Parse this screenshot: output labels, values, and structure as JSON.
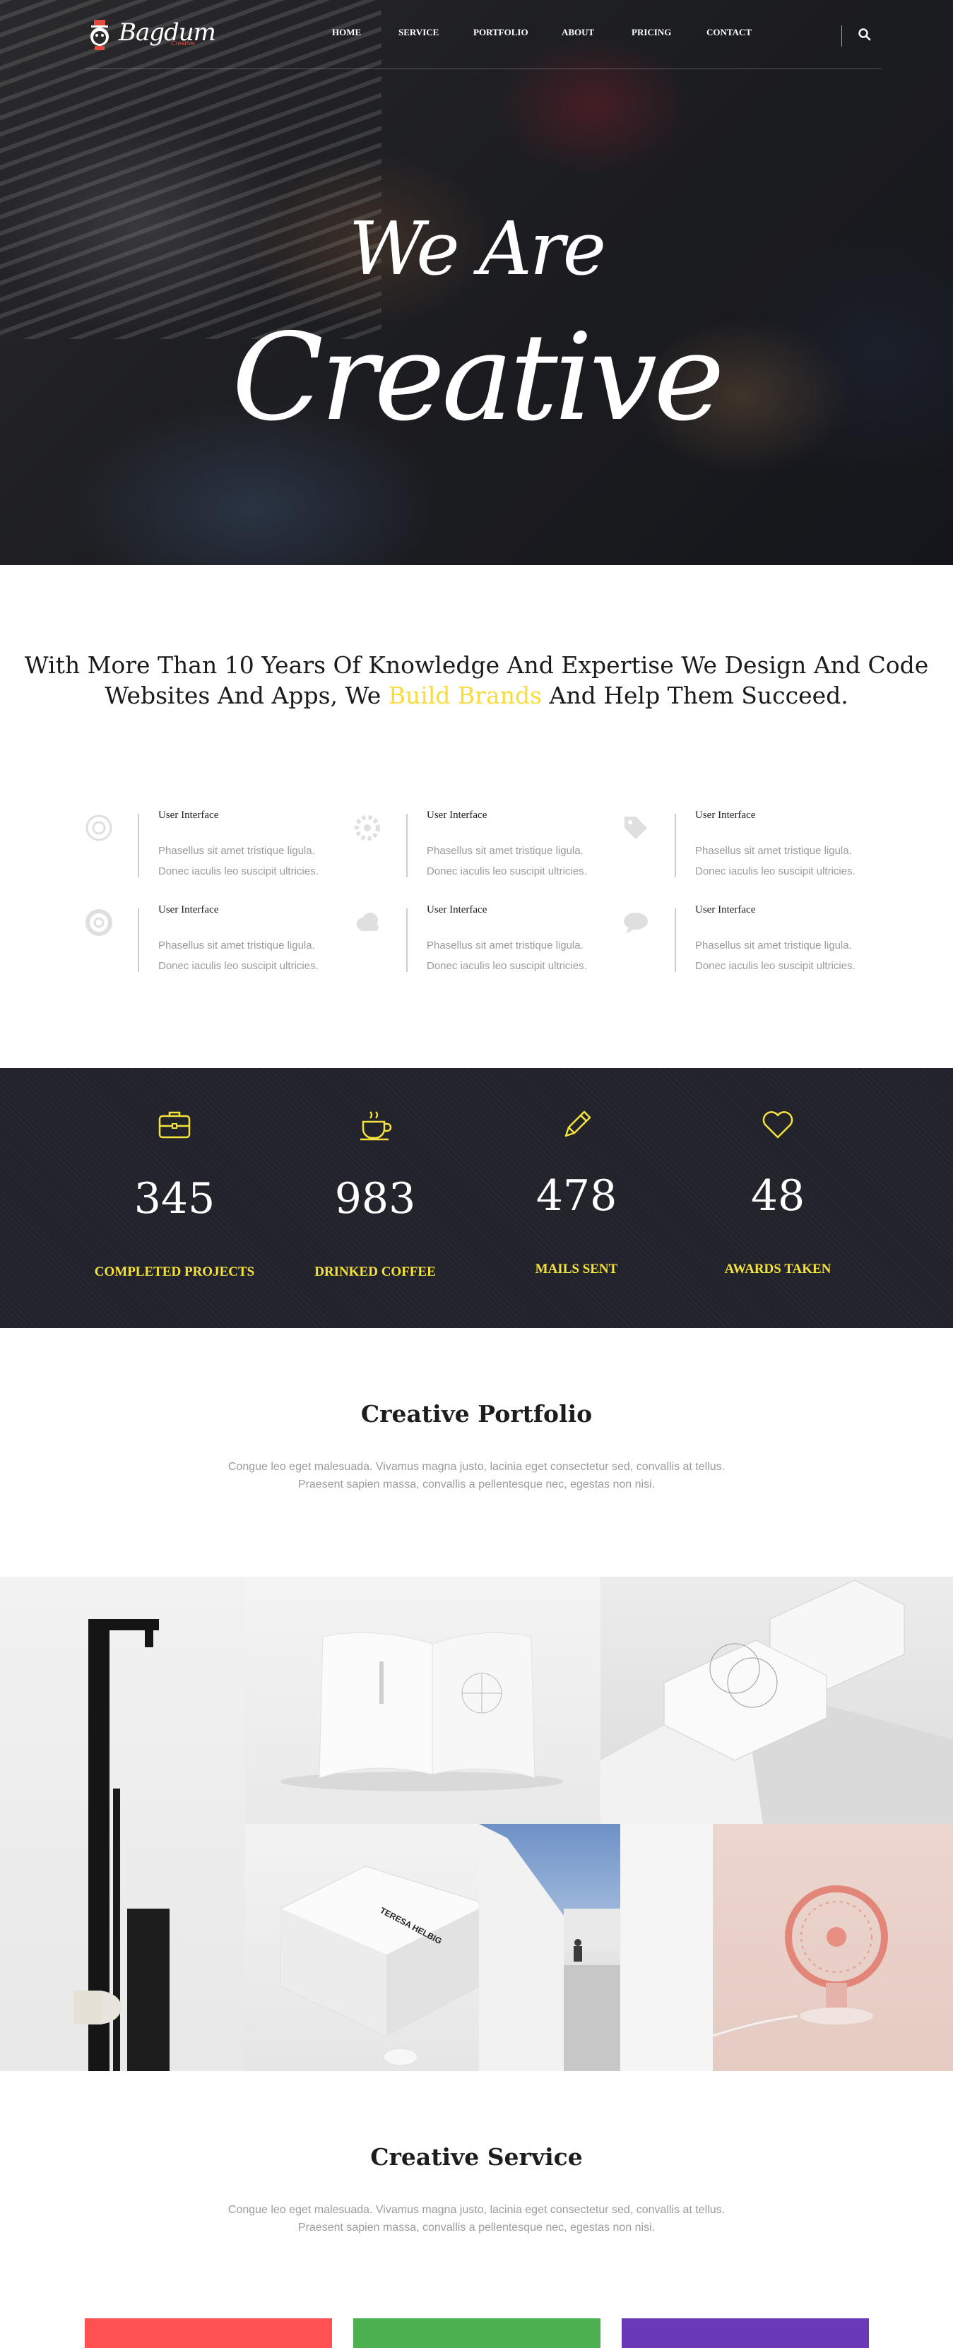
{
  "brand": {
    "name": "Bagdum",
    "tagline": "Creative"
  },
  "nav": {
    "items": [
      "HOME",
      "SERVICE",
      "PORTFOLIO",
      "ABOUT",
      "PRICING",
      "CONTACT"
    ],
    "search_icon": "search-icon"
  },
  "hero": {
    "line1": "We Are",
    "line2": "Creative"
  },
  "intro": {
    "text_before": "With More Than 10 Years Of Knowledge And Expertise We Design And Code Websites And Apps, We ",
    "highlight": "Build Brands",
    "text_after": " And Help Them Succeed.",
    "highlight_color": "#f7dc3c"
  },
  "features": [
    {
      "title": "User Interface",
      "line1": "Phasellus sit amet tristique ligula.",
      "line2": "Donec iaculis leo suscipit ultricies.",
      "icon": "target-icon"
    },
    {
      "title": "User Interface",
      "line1": "Phasellus sit amet tristique ligula.",
      "line2": "Donec iaculis leo suscipit ultricies.",
      "icon": "settings-icon"
    },
    {
      "title": "User Interface",
      "line1": "Phasellus sit amet tristique ligula.",
      "line2": "Donec iaculis leo suscipit ultricies.",
      "icon": "tag-icon"
    },
    {
      "title": "User Interface",
      "line1": "Phasellus sit amet tristique ligula.",
      "line2": "Donec iaculis leo suscipit ultricies.",
      "icon": "lifebuoy-icon"
    },
    {
      "title": "User Interface",
      "line1": "Phasellus sit amet tristique ligula.",
      "line2": "Donec iaculis leo suscipit ultricies.",
      "icon": "cloud-icon"
    },
    {
      "title": "User Interface",
      "line1": "Phasellus sit amet tristique ligula.",
      "line2": "Donec iaculis leo suscipit ultricies.",
      "icon": "chat-icon"
    }
  ],
  "stats": [
    {
      "value": "345",
      "label": "COMPLETED PROJECTS",
      "icon": "briefcase-icon"
    },
    {
      "value": "983",
      "label": "DRINKED COFFEE",
      "icon": "coffee-icon"
    },
    {
      "value": "478",
      "label": "MAILS SENT",
      "icon": "pencil-icon"
    },
    {
      "value": "48",
      "label": "AWARDS TAKEN",
      "icon": "heart-icon"
    }
  ],
  "stats_accent": "#f6e23c",
  "portfolio": {
    "title": "Creative Portfolio",
    "line1": "Congue leo eget malesuada. Vivamus magna justo, lacinia eget consectetur sed, convallis at tellus.",
    "line2": "Praesent sapien massa, convallis a pellentesque nec, egestas non nisi."
  },
  "portfolio_tile_text": "TERESA HELBIG",
  "service": {
    "title": "Creative Service",
    "line1": "Congue leo eget malesuada. Vivamus magna justo, lacinia eget consectetur sed, convallis at tellus.",
    "line2": "Praesent sapien massa, convallis a pellentesque nec, egestas non nisi.",
    "card_colors": [
      "#ff5151",
      "#4caf50",
      "#6a39b8"
    ]
  }
}
